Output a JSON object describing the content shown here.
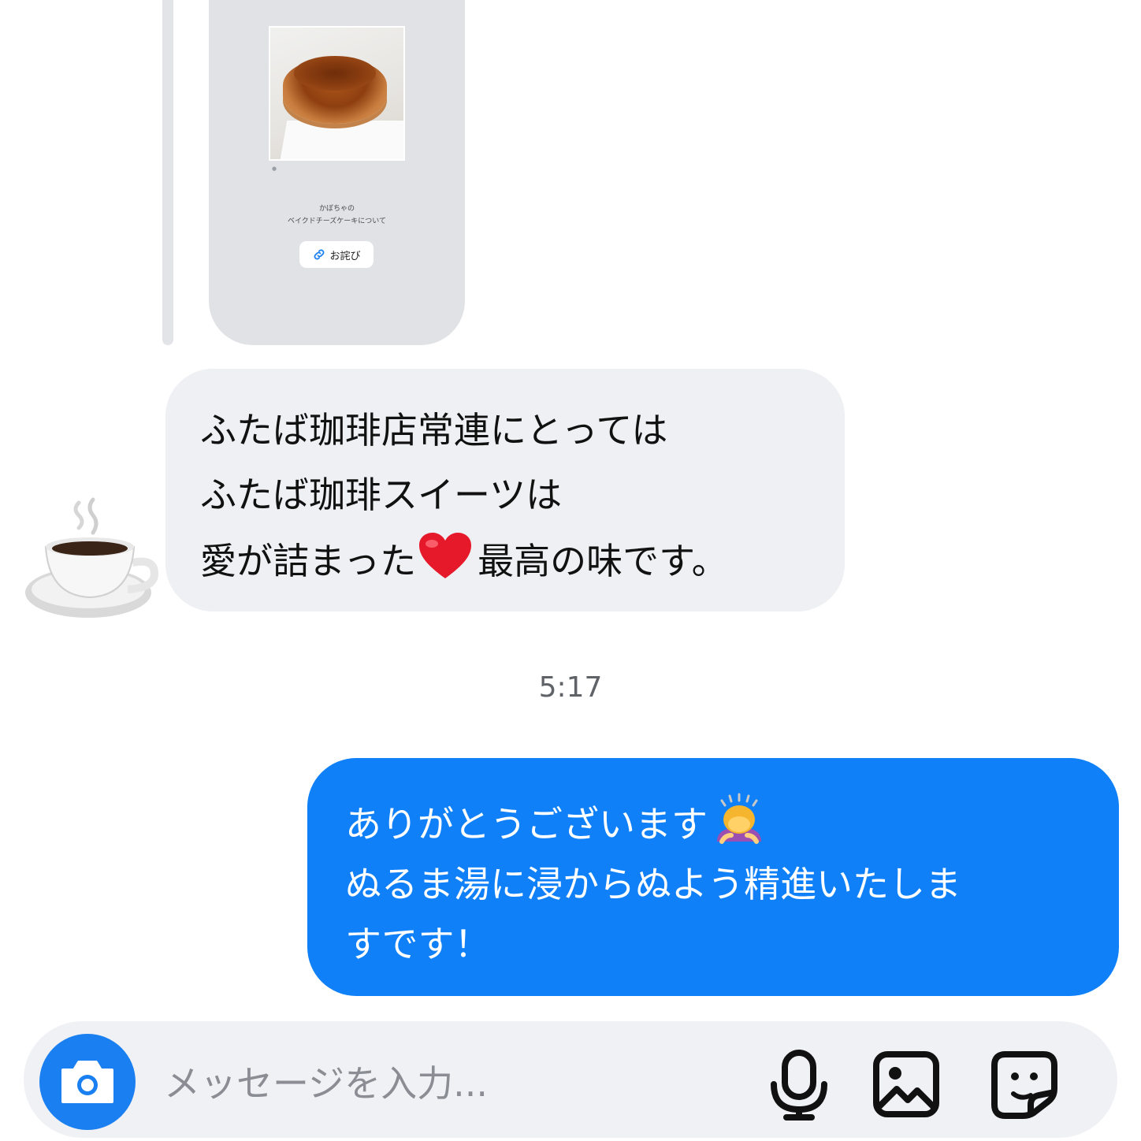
{
  "story": {
    "photo_credit": "●",
    "caption_line1": "かぼちゃの",
    "caption_line2": "ベイクドチーズケーキについて",
    "link_label": "お詫び",
    "link_icon": "link-icon"
  },
  "incoming": {
    "avatar_icon": "coffee-cup-icon",
    "line1": "ふたば珈琲店常連にとっては",
    "line2": "ふたば珈琲スイーツは",
    "line3_before": "愛が詰まった",
    "line3_emoji": "red-heart-icon",
    "line3_after": "最高の味です。"
  },
  "timestamp": "5:17",
  "outgoing": {
    "line1": "ありがとうございます",
    "line1_emoji": "person-bowing-icon",
    "line2": "ぬるま湯に浸からぬよう精進いたしま",
    "line3": "すです！"
  },
  "composer": {
    "placeholder": "メッセージを入力...",
    "camera_icon": "camera-icon",
    "mic_icon": "microphone-icon",
    "gallery_icon": "gallery-icon",
    "sticker_icon": "sticker-icon"
  },
  "colors": {
    "outgoing_bubble": "#0f80f8",
    "incoming_bubble": "#eff0f3",
    "camera_button": "#1a7ff0"
  }
}
